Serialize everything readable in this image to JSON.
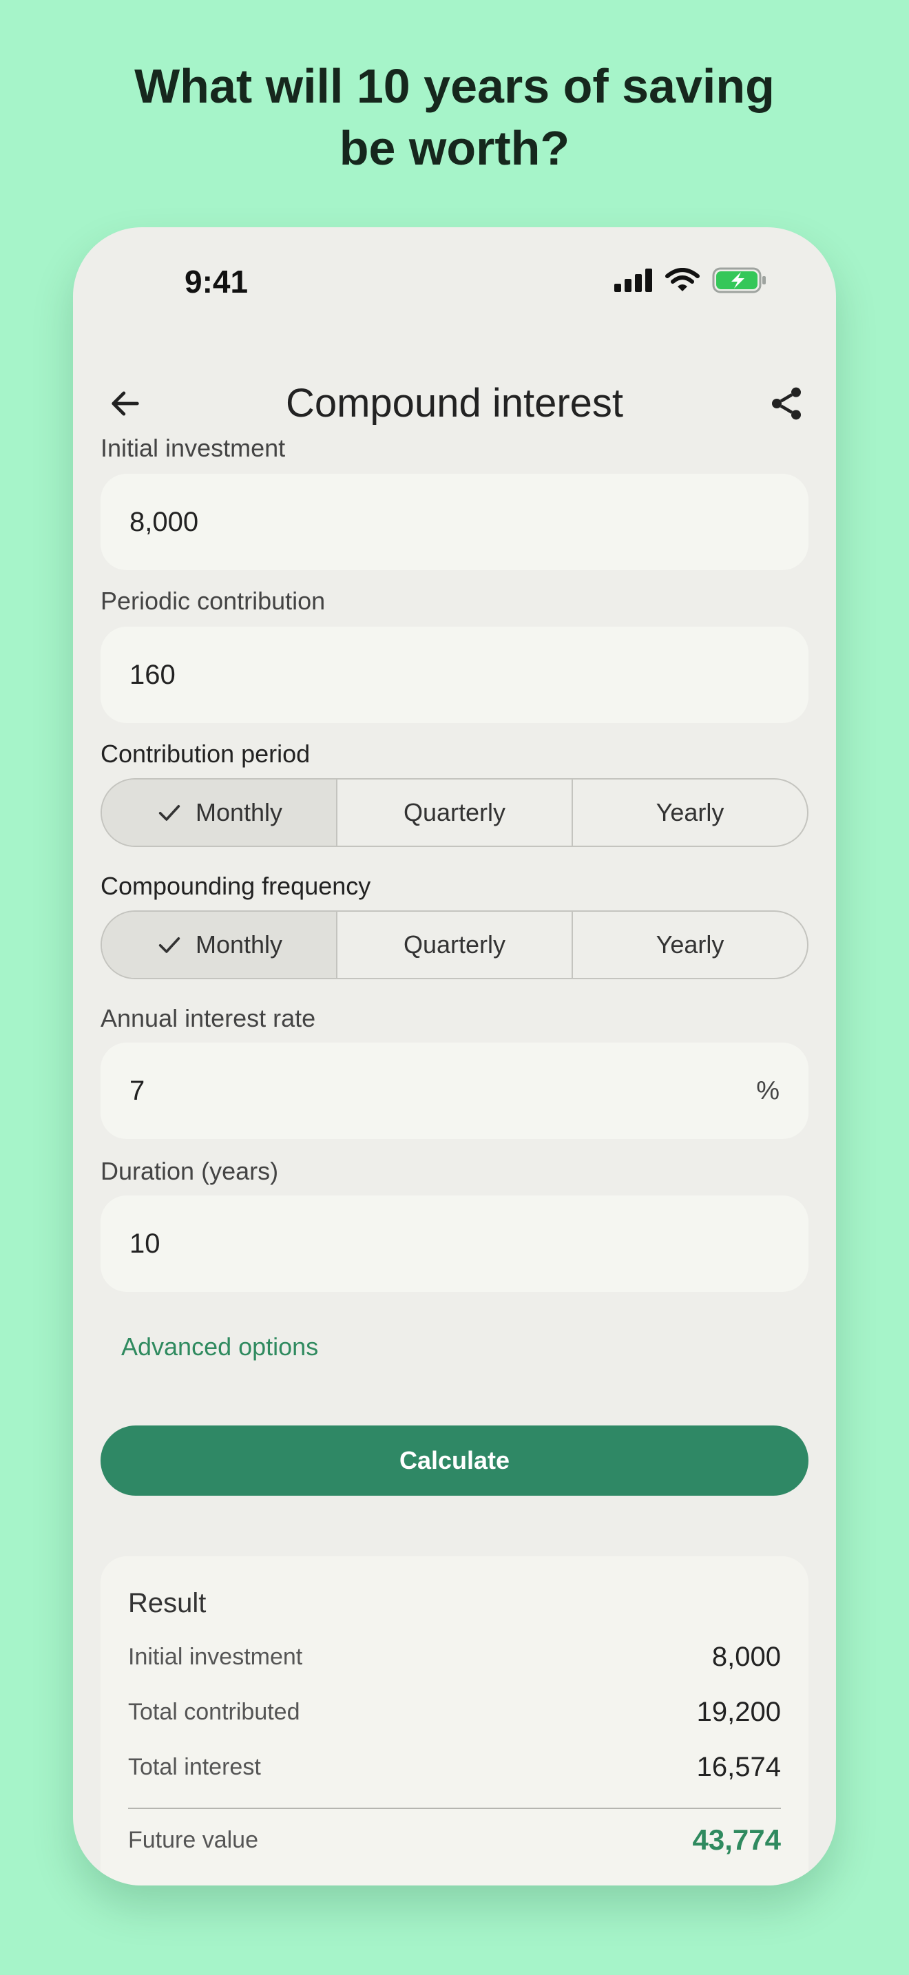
{
  "headline": {
    "line1": "What will 10 years of saving",
    "line2": "be worth?"
  },
  "status": {
    "time": "9:41"
  },
  "header": {
    "title": "Compound interest",
    "back_icon": "arrow-left-icon",
    "share_icon": "share-icon"
  },
  "form": {
    "initial": {
      "label": "Initial investment",
      "value": "8,000"
    },
    "periodic": {
      "label": "Periodic contribution",
      "value": "160"
    },
    "contribution_period": {
      "label": "Contribution period",
      "options": [
        "Monthly",
        "Quarterly",
        "Yearly"
      ],
      "selected": "Monthly"
    },
    "compounding": {
      "label": "Compounding frequency",
      "options": [
        "Monthly",
        "Quarterly",
        "Yearly"
      ],
      "selected": "Monthly"
    },
    "rate": {
      "label": "Annual interest rate",
      "value": "7",
      "suffix": "%"
    },
    "duration": {
      "label": "Duration (years)",
      "value": "10"
    },
    "advanced_label": "Advanced options",
    "calculate_label": "Calculate"
  },
  "result": {
    "title": "Result",
    "rows": [
      {
        "label": "Initial investment",
        "value": "8,000"
      },
      {
        "label": "Total contributed",
        "value": "19,200"
      },
      {
        "label": "Total interest",
        "value": "16,574"
      }
    ],
    "future": {
      "label": "Future value",
      "value": "43,774"
    }
  },
  "colors": {
    "background": "#a6f4c9",
    "accent": "#2f8865",
    "accent_text": "#2f8a5f",
    "battery": "#35c759"
  }
}
